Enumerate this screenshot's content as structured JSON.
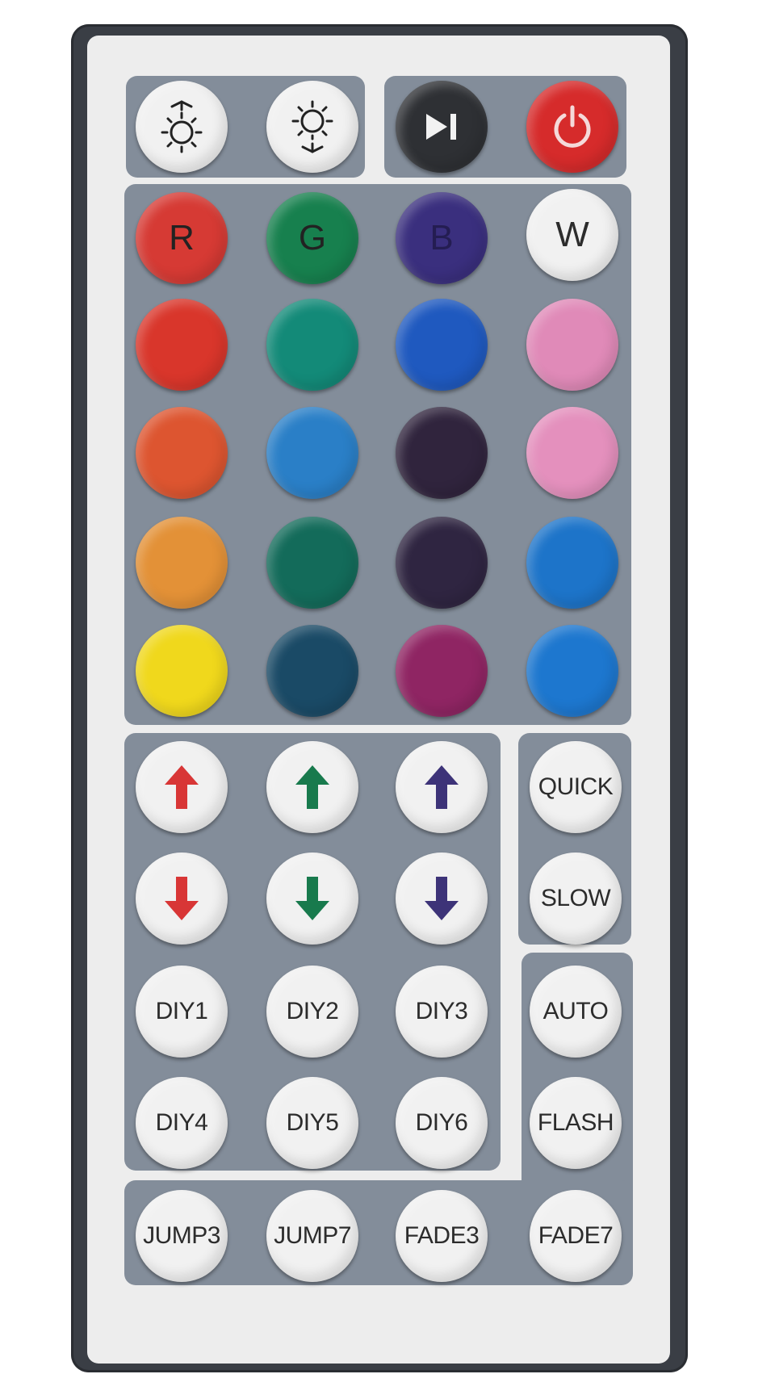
{
  "top_row": {
    "brightness_up_icon": "brightness-up-icon",
    "brightness_down_icon": "brightness-down-icon",
    "play_pause_icon": "play-pause-icon",
    "power_icon": "power-icon"
  },
  "color_buttons": {
    "r_label": "R",
    "g_label": "G",
    "b_label": "B",
    "w_label": "W"
  },
  "colors": {
    "rows": [
      [
        "#d63a34",
        "#17804e",
        "#3a2f7e",
        "#f2f2f2"
      ],
      [
        "#d9362b",
        "#138a78",
        "#1f59bf",
        "#e08ab8"
      ],
      [
        "#dd5530",
        "#2a7fc7",
        "#30243d",
        "#e490bd"
      ],
      [
        "#e39137",
        "#136b5a",
        "#2f2541",
        "#1d74c9"
      ],
      [
        "#f0d81c",
        "#1a4a66",
        "#8f2563",
        "#1d77cf"
      ]
    ]
  },
  "arrows": {
    "red": "#d83636",
    "green": "#187a4d",
    "blue": "#3d3378"
  },
  "speed": {
    "quick_label": "QUICK",
    "slow_label": "SLOW"
  },
  "diy": {
    "diy1": "DIY1",
    "diy2": "DIY2",
    "diy3": "DIY3",
    "diy4": "DIY4",
    "diy5": "DIY5",
    "diy6": "DIY6"
  },
  "modes": {
    "auto_label": "AUTO",
    "flash_label": "FLASH",
    "jump3_label": "JUMP3",
    "jump7_label": "JUMP7",
    "fade3_label": "FADE3",
    "fade7_label": "FADE7"
  }
}
